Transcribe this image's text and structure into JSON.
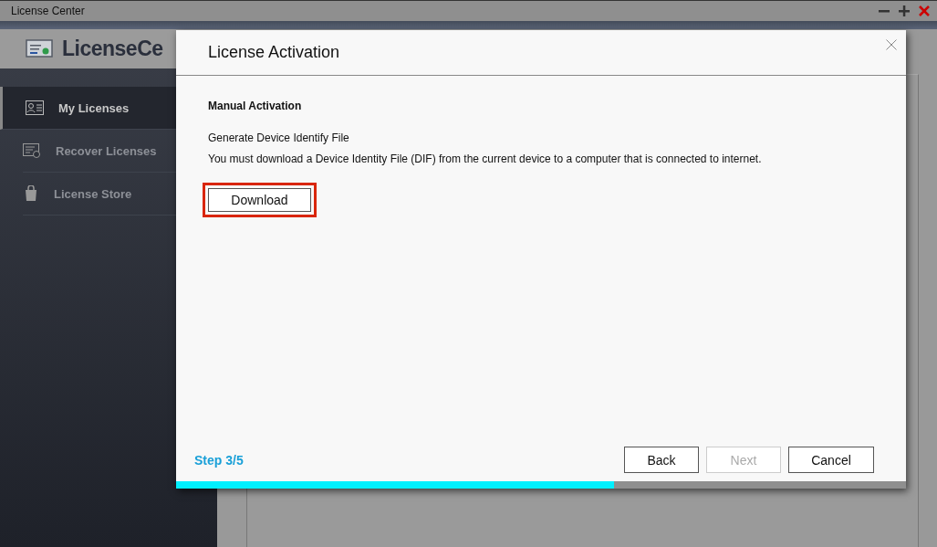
{
  "window": {
    "title": "License Center"
  },
  "app": {
    "logo_text": "LicenseCe"
  },
  "sidebar": {
    "items": [
      {
        "label": "My Licenses",
        "selected": true
      },
      {
        "label": "Recover Licenses",
        "selected": false
      },
      {
        "label": "License Store",
        "selected": false
      }
    ]
  },
  "dialog": {
    "title": "License Activation",
    "section": "Manual Activation",
    "subheading": "Generate Device Identify File",
    "description": "You must download a Device Identity File (DIF) from the current device to a computer that is connected to internet.",
    "download_button": {
      "label": "Download",
      "highlighted": true
    },
    "step": "Step 3/5",
    "buttons": [
      {
        "label": "Back",
        "disabled": false
      },
      {
        "label": "Next",
        "disabled": true
      },
      {
        "label": "Cancel",
        "disabled": false
      }
    ],
    "progress": {
      "level": 0.6
    }
  }
}
